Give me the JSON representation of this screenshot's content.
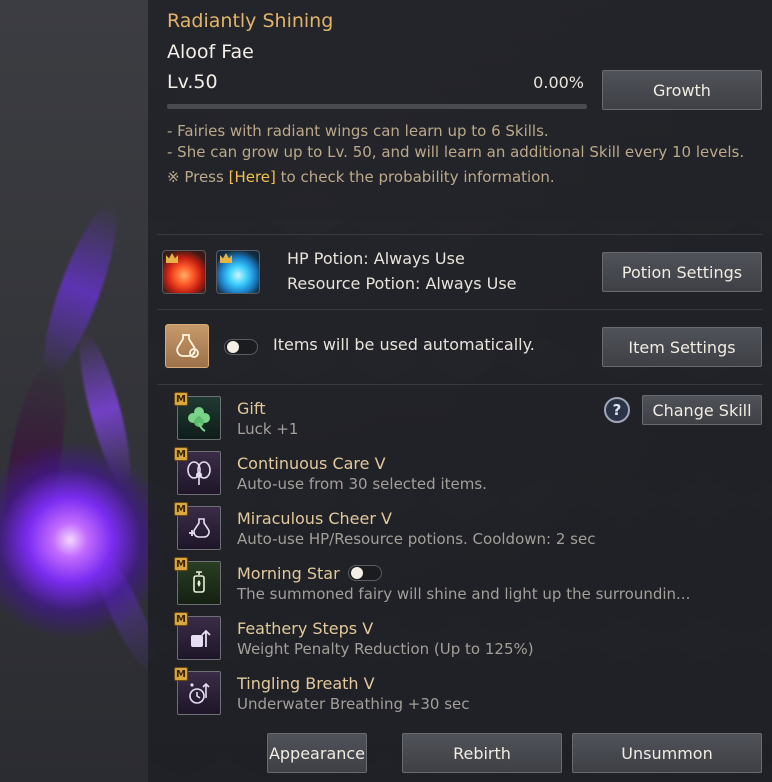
{
  "pet": {
    "rarity": "Radiantly Shining",
    "name": "Aloof Fae",
    "level": "Lv.50",
    "progress_text": "0.00%",
    "progress_fraction": 0.0,
    "growth_button": "Growth"
  },
  "description": {
    "line1": "- Fairies with radiant wings can learn up to 6 Skills.",
    "line2": "- She can grow up to Lv. 50, and will learn an additional Skill every 10 levels.",
    "line3_prefix": "※ Press ",
    "line3_link": "[Here]",
    "line3_suffix": " to check the probability information."
  },
  "potions": {
    "hp_potion": "HP Potion: Always Use",
    "resource_potion": "Resource Potion: Always Use",
    "settings_button": "Potion Settings",
    "hp_icon": "red-potion-icon",
    "resource_icon": "blue-potion-icon"
  },
  "items": {
    "auto_text": "Items will be used automatically.",
    "auto_toggle_on": false,
    "settings_button": "Item Settings",
    "icon": "potion-gear-icon"
  },
  "skills_header": {
    "help_glyph": "?",
    "change_skill_button": "Change Skill"
  },
  "skills": [
    {
      "badge": "M",
      "name": "Gift",
      "desc": "Luck +1",
      "icon": "clover-icon"
    },
    {
      "badge": "M",
      "name": "Continuous Care V",
      "desc": "Auto-use from 30 selected items.",
      "icon": "fairy-icon"
    },
    {
      "badge": "M",
      "name": "Miraculous Cheer V",
      "desc": "Auto-use HP/Resource potions. Cooldown: 2 sec",
      "icon": "potion-plus-icon"
    },
    {
      "badge": "M",
      "name": "Morning Star",
      "desc": "The summoned fairy will shine and light up the surroundin...",
      "icon": "lantern-icon",
      "toggle_on": false
    },
    {
      "badge": "M",
      "name": "Feathery Steps V",
      "desc": "Weight Penalty Reduction (Up to 125%)",
      "icon": "weight-icon"
    },
    {
      "badge": "M",
      "name": "Tingling Breath V",
      "desc": "Underwater Breathing +30 sec",
      "icon": "breath-timer-icon"
    }
  ],
  "footer": {
    "appearance_button": "Appearance",
    "rebirth_button": "Rebirth",
    "unsummon_button": "Unsummon"
  },
  "colors": {
    "accent_gold": "#e2b469",
    "link_yellow": "#f1c14a",
    "skill_name": "#e2c99b",
    "orb_purple": "#7a2cf0"
  }
}
